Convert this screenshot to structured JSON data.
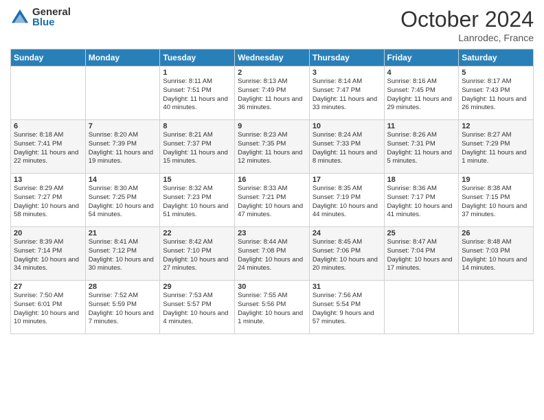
{
  "logo": {
    "general": "General",
    "blue": "Blue"
  },
  "header": {
    "month": "October 2024",
    "location": "Lanrodec, France"
  },
  "weekdays": [
    "Sunday",
    "Monday",
    "Tuesday",
    "Wednesday",
    "Thursday",
    "Friday",
    "Saturday"
  ],
  "weeks": [
    [
      {
        "day": "",
        "sunrise": "",
        "sunset": "",
        "daylight": ""
      },
      {
        "day": "",
        "sunrise": "",
        "sunset": "",
        "daylight": ""
      },
      {
        "day": "1",
        "sunrise": "Sunrise: 8:11 AM",
        "sunset": "Sunset: 7:51 PM",
        "daylight": "Daylight: 11 hours and 40 minutes."
      },
      {
        "day": "2",
        "sunrise": "Sunrise: 8:13 AM",
        "sunset": "Sunset: 7:49 PM",
        "daylight": "Daylight: 11 hours and 36 minutes."
      },
      {
        "day": "3",
        "sunrise": "Sunrise: 8:14 AM",
        "sunset": "Sunset: 7:47 PM",
        "daylight": "Daylight: 11 hours and 33 minutes."
      },
      {
        "day": "4",
        "sunrise": "Sunrise: 8:16 AM",
        "sunset": "Sunset: 7:45 PM",
        "daylight": "Daylight: 11 hours and 29 minutes."
      },
      {
        "day": "5",
        "sunrise": "Sunrise: 8:17 AM",
        "sunset": "Sunset: 7:43 PM",
        "daylight": "Daylight: 11 hours and 26 minutes."
      }
    ],
    [
      {
        "day": "6",
        "sunrise": "Sunrise: 8:18 AM",
        "sunset": "Sunset: 7:41 PM",
        "daylight": "Daylight: 11 hours and 22 minutes."
      },
      {
        "day": "7",
        "sunrise": "Sunrise: 8:20 AM",
        "sunset": "Sunset: 7:39 PM",
        "daylight": "Daylight: 11 hours and 19 minutes."
      },
      {
        "day": "8",
        "sunrise": "Sunrise: 8:21 AM",
        "sunset": "Sunset: 7:37 PM",
        "daylight": "Daylight: 11 hours and 15 minutes."
      },
      {
        "day": "9",
        "sunrise": "Sunrise: 8:23 AM",
        "sunset": "Sunset: 7:35 PM",
        "daylight": "Daylight: 11 hours and 12 minutes."
      },
      {
        "day": "10",
        "sunrise": "Sunrise: 8:24 AM",
        "sunset": "Sunset: 7:33 PM",
        "daylight": "Daylight: 11 hours and 8 minutes."
      },
      {
        "day": "11",
        "sunrise": "Sunrise: 8:26 AM",
        "sunset": "Sunset: 7:31 PM",
        "daylight": "Daylight: 11 hours and 5 minutes."
      },
      {
        "day": "12",
        "sunrise": "Sunrise: 8:27 AM",
        "sunset": "Sunset: 7:29 PM",
        "daylight": "Daylight: 11 hours and 1 minute."
      }
    ],
    [
      {
        "day": "13",
        "sunrise": "Sunrise: 8:29 AM",
        "sunset": "Sunset: 7:27 PM",
        "daylight": "Daylight: 10 hours and 58 minutes."
      },
      {
        "day": "14",
        "sunrise": "Sunrise: 8:30 AM",
        "sunset": "Sunset: 7:25 PM",
        "daylight": "Daylight: 10 hours and 54 minutes."
      },
      {
        "day": "15",
        "sunrise": "Sunrise: 8:32 AM",
        "sunset": "Sunset: 7:23 PM",
        "daylight": "Daylight: 10 hours and 51 minutes."
      },
      {
        "day": "16",
        "sunrise": "Sunrise: 8:33 AM",
        "sunset": "Sunset: 7:21 PM",
        "daylight": "Daylight: 10 hours and 47 minutes."
      },
      {
        "day": "17",
        "sunrise": "Sunrise: 8:35 AM",
        "sunset": "Sunset: 7:19 PM",
        "daylight": "Daylight: 10 hours and 44 minutes."
      },
      {
        "day": "18",
        "sunrise": "Sunrise: 8:36 AM",
        "sunset": "Sunset: 7:17 PM",
        "daylight": "Daylight: 10 hours and 41 minutes."
      },
      {
        "day": "19",
        "sunrise": "Sunrise: 8:38 AM",
        "sunset": "Sunset: 7:15 PM",
        "daylight": "Daylight: 10 hours and 37 minutes."
      }
    ],
    [
      {
        "day": "20",
        "sunrise": "Sunrise: 8:39 AM",
        "sunset": "Sunset: 7:14 PM",
        "daylight": "Daylight: 10 hours and 34 minutes."
      },
      {
        "day": "21",
        "sunrise": "Sunrise: 8:41 AM",
        "sunset": "Sunset: 7:12 PM",
        "daylight": "Daylight: 10 hours and 30 minutes."
      },
      {
        "day": "22",
        "sunrise": "Sunrise: 8:42 AM",
        "sunset": "Sunset: 7:10 PM",
        "daylight": "Daylight: 10 hours and 27 minutes."
      },
      {
        "day": "23",
        "sunrise": "Sunrise: 8:44 AM",
        "sunset": "Sunset: 7:08 PM",
        "daylight": "Daylight: 10 hours and 24 minutes."
      },
      {
        "day": "24",
        "sunrise": "Sunrise: 8:45 AM",
        "sunset": "Sunset: 7:06 PM",
        "daylight": "Daylight: 10 hours and 20 minutes."
      },
      {
        "day": "25",
        "sunrise": "Sunrise: 8:47 AM",
        "sunset": "Sunset: 7:04 PM",
        "daylight": "Daylight: 10 hours and 17 minutes."
      },
      {
        "day": "26",
        "sunrise": "Sunrise: 8:48 AM",
        "sunset": "Sunset: 7:03 PM",
        "daylight": "Daylight: 10 hours and 14 minutes."
      }
    ],
    [
      {
        "day": "27",
        "sunrise": "Sunrise: 7:50 AM",
        "sunset": "Sunset: 6:01 PM",
        "daylight": "Daylight: 10 hours and 10 minutes."
      },
      {
        "day": "28",
        "sunrise": "Sunrise: 7:52 AM",
        "sunset": "Sunset: 5:59 PM",
        "daylight": "Daylight: 10 hours and 7 minutes."
      },
      {
        "day": "29",
        "sunrise": "Sunrise: 7:53 AM",
        "sunset": "Sunset: 5:57 PM",
        "daylight": "Daylight: 10 hours and 4 minutes."
      },
      {
        "day": "30",
        "sunrise": "Sunrise: 7:55 AM",
        "sunset": "Sunset: 5:56 PM",
        "daylight": "Daylight: 10 hours and 1 minute."
      },
      {
        "day": "31",
        "sunrise": "Sunrise: 7:56 AM",
        "sunset": "Sunset: 5:54 PM",
        "daylight": "Daylight: 9 hours and 57 minutes."
      },
      {
        "day": "",
        "sunrise": "",
        "sunset": "",
        "daylight": ""
      },
      {
        "day": "",
        "sunrise": "",
        "sunset": "",
        "daylight": ""
      }
    ]
  ]
}
